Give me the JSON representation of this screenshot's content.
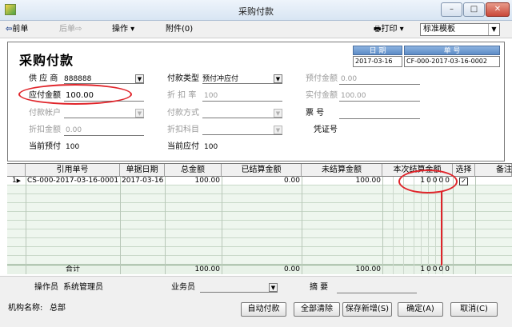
{
  "window": {
    "title": "采购付款",
    "min_glyph": "–",
    "max_glyph": "□",
    "close_glyph": "✕"
  },
  "toolbar": {
    "prev": "前单",
    "next": "后单",
    "operate": "操作",
    "attachment": "附件(0)",
    "print": "打印",
    "template": "标准模板"
  },
  "form": {
    "title": "采购付款",
    "date_label": "日 期",
    "date": "2017-03-16",
    "no_label": "单 号",
    "no": "CF-000-2017-03-16-0002",
    "supplier_label": "供 应 商",
    "supplier": "888888",
    "pay_type_label": "付款类型",
    "pay_type": "预付冲应付",
    "prepay_amount_label": "预付金额",
    "prepay_amount": "0.00",
    "payable_amount_label": "应付金额",
    "payable_amount": "100.00",
    "discount_rate_label": "折 扣 率",
    "discount_rate": "100",
    "actual_amount_label": "实付金额",
    "actual_amount": "100.00",
    "account_label": "付款帐户",
    "pay_method_label": "付款方式",
    "invoice_label": "票 号",
    "discount_amount_label": "折扣金额",
    "discount_amount": "0.00",
    "discount_subject_label": "折扣科目",
    "voucher_label": "凭证号",
    "current_prepay_label": "当前预付",
    "current_prepay": "100",
    "current_payable_label": "当前应付",
    "current_payable": "100"
  },
  "grid": {
    "columns": [
      "引用单号",
      "单据日期",
      "总金额",
      "已结算金额",
      "未结算金额",
      "本次结算金额",
      "选择",
      "备注"
    ],
    "rows": [
      {
        "num": "1",
        "ref": "CS-000-2017-03-16-0001",
        "date": "2017-03-16",
        "total": "100.00",
        "settled": "0.00",
        "unsettled": "100.00",
        "this": "10000",
        "checked": "✓"
      }
    ],
    "total_label": "合计",
    "total_total": "100.00",
    "total_settled": "0.00",
    "total_unsettled": "100.00",
    "total_this": "10000"
  },
  "footer": {
    "operator_label": "操作员",
    "operator": "系统管理员",
    "salesman_label": "业务员",
    "summary_label": "摘 要",
    "org_label": "机构名称:",
    "org": "总部",
    "btn_auto": "自动付款",
    "btn_clear": "全部清除",
    "btn_save_new": "保存新增(S)",
    "btn_ok": "确定(A)",
    "btn_cancel": "取消(C)"
  },
  "colors": {
    "accent": "#5d8cc6",
    "annotation": "#e0242a"
  }
}
